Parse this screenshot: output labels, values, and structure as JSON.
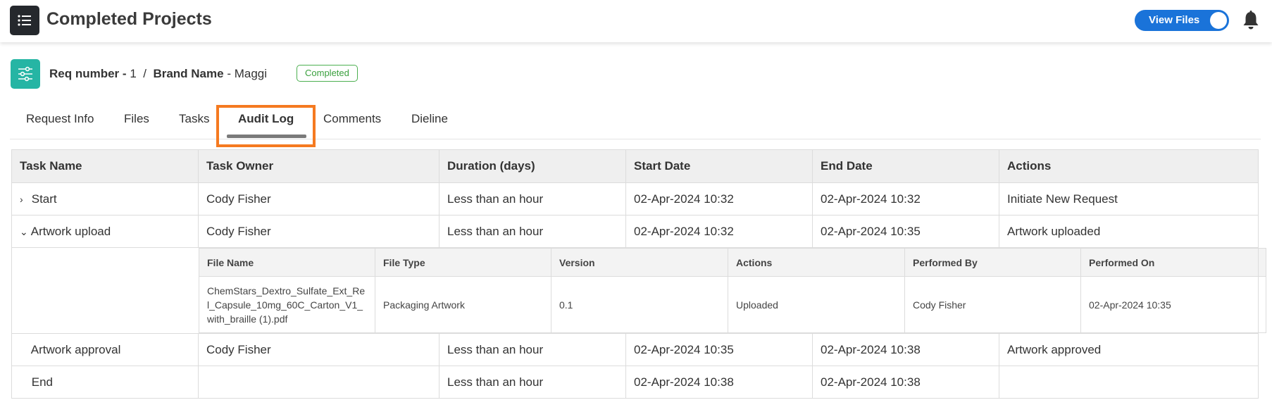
{
  "header": {
    "title": "Completed Projects",
    "view_files_label": "View Files",
    "view_files_on": true
  },
  "request": {
    "req_label": "Req number",
    "req_value": "1",
    "separator": "/",
    "brand_label": "Brand Name",
    "brand_value": "Maggi",
    "dash": "-",
    "status": "Completed"
  },
  "tabs": [
    {
      "label": "Request Info"
    },
    {
      "label": "Files"
    },
    {
      "label": "Tasks"
    },
    {
      "label": "Audit Log",
      "active": true
    },
    {
      "label": "Comments"
    },
    {
      "label": "Dieline"
    }
  ],
  "audit_table": {
    "columns": [
      "Task Name",
      "Task Owner",
      "Duration (days)",
      "Start Date",
      "End Date",
      "Actions"
    ],
    "rows": [
      {
        "expander": "›",
        "task": "Start",
        "owner": "Cody Fisher",
        "duration": "Less than an hour",
        "start": "02-Apr-2024 10:32",
        "end": "02-Apr-2024 10:32",
        "action": "Initiate New Request"
      },
      {
        "expander": "⌄",
        "task": "Artwork upload",
        "owner": "Cody Fisher",
        "duration": "Less than an hour",
        "start": "02-Apr-2024 10:32",
        "end": "02-Apr-2024 10:35",
        "action": "Artwork uploaded"
      },
      {
        "expander": "",
        "task": "Artwork approval",
        "owner": "Cody Fisher",
        "duration": "Less than an hour",
        "start": "02-Apr-2024 10:35",
        "end": "02-Apr-2024 10:38",
        "action": "Artwork approved"
      },
      {
        "expander": "",
        "task": "End",
        "owner": "",
        "duration": "Less than an hour",
        "start": "02-Apr-2024 10:38",
        "end": "02-Apr-2024 10:38",
        "action": ""
      }
    ]
  },
  "files_subtable": {
    "columns": [
      "File Name",
      "File Type",
      "Version",
      "Actions",
      "Performed By",
      "Performed On"
    ],
    "rows": [
      {
        "file_name": "ChemStars_Dextro_Sulfate_Ext_Rel_Capsule_10mg_60C_Carton_V1_with_braille (1).pdf",
        "file_type": "Packaging Artwork",
        "version": "0.1",
        "action": "Uploaded",
        "performed_by": "Cody Fisher",
        "performed_on": "02-Apr-2024 10:35"
      }
    ]
  },
  "colors": {
    "accent_blue": "#1a73d9",
    "teal": "#26b5a4",
    "status_green": "#3aa03e",
    "highlight_orange": "#f57a20"
  }
}
